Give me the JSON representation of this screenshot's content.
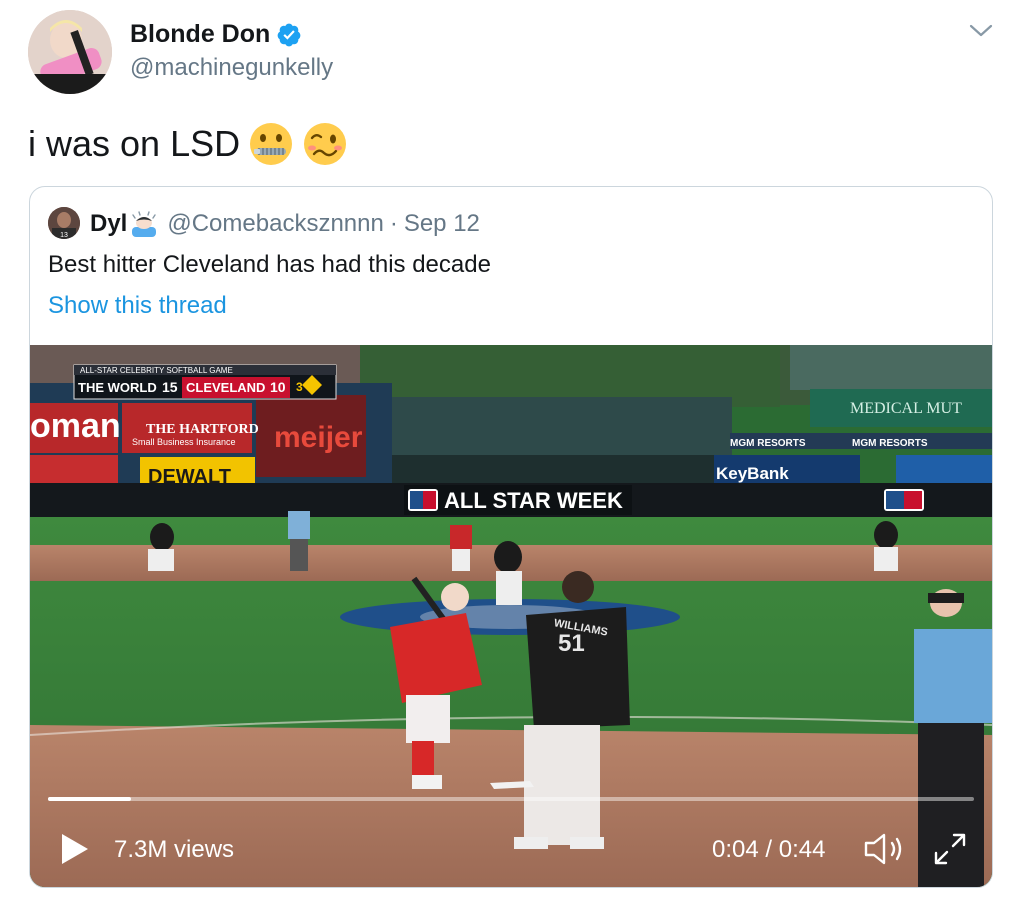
{
  "author": {
    "name": "Blonde Don",
    "handle": "@machinegunkelly",
    "verified": true
  },
  "tweet": {
    "text": "i was on LSD",
    "emojis": [
      "zipper-mouth-face-emoji",
      "woozy-face-emoji"
    ]
  },
  "quoted": {
    "name": "Dyl",
    "name_emoji": "person-bowing-emoji",
    "handle": "@Comebacksznnnn",
    "separator": "·",
    "date": "Sep 12",
    "text": "Best hitter Cleveland has had this decade",
    "show_thread": "Show this thread"
  },
  "video": {
    "views": "7.3M views",
    "time": "0:04 / 0:44",
    "progress_fraction": 0.09,
    "scoreboard": {
      "title": "ALL-STAR CELEBRITY SOFTBALL GAME",
      "team1": "THE WORLD",
      "score1": "15",
      "team2": "CLEVELAND",
      "score2": "10",
      "inning": "3"
    },
    "signage": {
      "hartford": "THE HARTFORD",
      "hartford_sub": "Small Business Insurance",
      "meijer": "meijer",
      "dewalt": "DEWALT",
      "mgm1": "MGM RESORTS",
      "mgm2": "MGM RESORTS",
      "allstar_week": "ALL STAR WEEK",
      "keybank": "KeyBank",
      "medical": "MEDICAL MUT",
      "jersey_name": "WILLIAMS",
      "jersey_number": "51"
    }
  },
  "colors": {
    "link": "#1b95e0",
    "secondary_text": "#657786",
    "verified": "#1da1f2"
  }
}
